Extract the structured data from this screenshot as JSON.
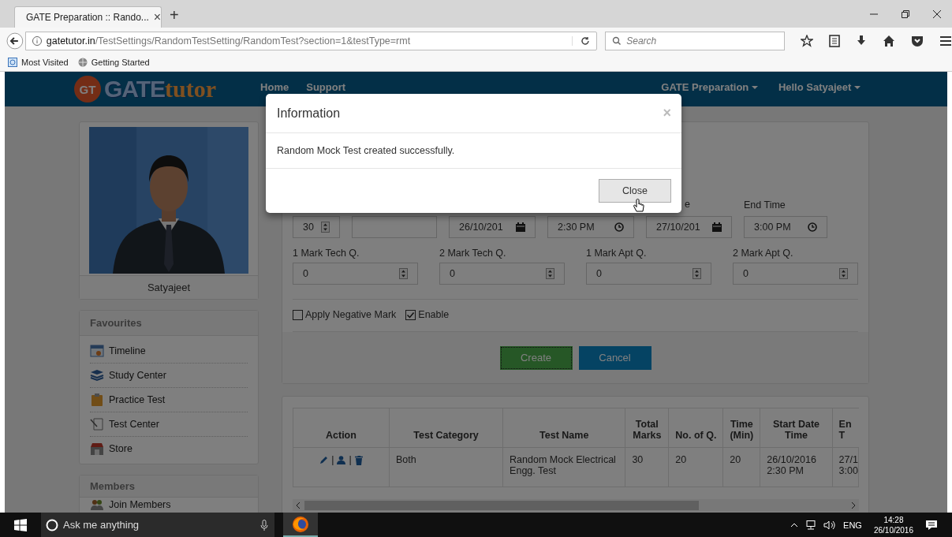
{
  "browser": {
    "tab_title": "GATE Preparation :: Rando...",
    "tab_close": "×",
    "new_tab": "+",
    "url_host": "gatetutor.in",
    "url_path": "/TestSettings/RandomTestSetting/RandomTest?section=1&testType=rmt",
    "search_placeholder": "Search",
    "bookmarks": [
      "Most Visited",
      "Getting Started"
    ]
  },
  "navbar": {
    "logo_badge": "GT",
    "logo_main": "GATE",
    "logo_sub": "tutor",
    "links": [
      "Home",
      "Support"
    ],
    "menus": [
      "GATE Preparation",
      "Hello Satyajeet"
    ]
  },
  "profile": {
    "name": "Satyajeet"
  },
  "favourites": {
    "title": "Favourites",
    "items": [
      {
        "label": "Timeline"
      },
      {
        "label": "Study Center"
      },
      {
        "label": "Practice Test"
      },
      {
        "label": "Test Center"
      },
      {
        "label": "Store"
      }
    ]
  },
  "members": {
    "title": "Members",
    "items": [
      {
        "label": "Join Members"
      }
    ]
  },
  "form": {
    "row1": [
      {
        "kind": "number",
        "value": "30"
      },
      {
        "kind": "text"
      },
      {
        "kind": "date",
        "value": "26/10/201"
      },
      {
        "kind": "time",
        "value": "2:30 PM"
      },
      {
        "kind": "date",
        "value": "27/10/201",
        "label": "e"
      },
      {
        "kind": "time",
        "value": "3:00 PM",
        "label": "End Time"
      }
    ],
    "row2": [
      {
        "label": "1 Mark Tech Q.",
        "value": "0"
      },
      {
        "label": "2 Mark Tech Q.",
        "value": "0"
      },
      {
        "label": "1 Mark Apt Q.",
        "value": "0"
      },
      {
        "label": "2 Mark Apt Q.",
        "value": "0"
      }
    ],
    "checkboxes": [
      {
        "label": "Apply Negative Mark",
        "checked": false
      },
      {
        "label": "Enable",
        "checked": true
      }
    ],
    "buttons": [
      {
        "label": "Create",
        "kind": "create",
        "focused": true
      },
      {
        "label": "Cancel",
        "kind": "cancel",
        "focused": false
      }
    ]
  },
  "table": {
    "columns": [
      "Action",
      "Test Category",
      "Test Name",
      "Total Marks",
      "No. of Q.",
      "Time (Min)",
      "Start Date Time",
      "En T"
    ],
    "rows": [
      {
        "cells": [
          {
            "kind": "actions",
            "actions": [
              {
                "kind": "edit"
              },
              {
                "kind": "user"
              },
              {
                "kind": "delete"
              }
            ],
            "separators": [
              "|",
              "|"
            ]
          },
          {
            "kind": "text",
            "text": "Both"
          },
          {
            "kind": "text",
            "text": "Random Mock Electrical Engg. Test"
          },
          {
            "kind": "text",
            "text": "30"
          },
          {
            "kind": "text",
            "text": "20"
          },
          {
            "kind": "text",
            "text": "20"
          },
          {
            "kind": "text",
            "text": "26/10/2016 2:30 PM"
          },
          {
            "kind": "text",
            "text": "27/1 3:00"
          }
        ]
      }
    ]
  },
  "modal": {
    "title": "Information",
    "close": "×",
    "message": "Random Mock Test created successfully.",
    "button": "Close"
  },
  "taskbar": {
    "search_placeholder": "Ask me anything",
    "language": "ENG",
    "time": "14:28",
    "date": "26/10/2016"
  }
}
